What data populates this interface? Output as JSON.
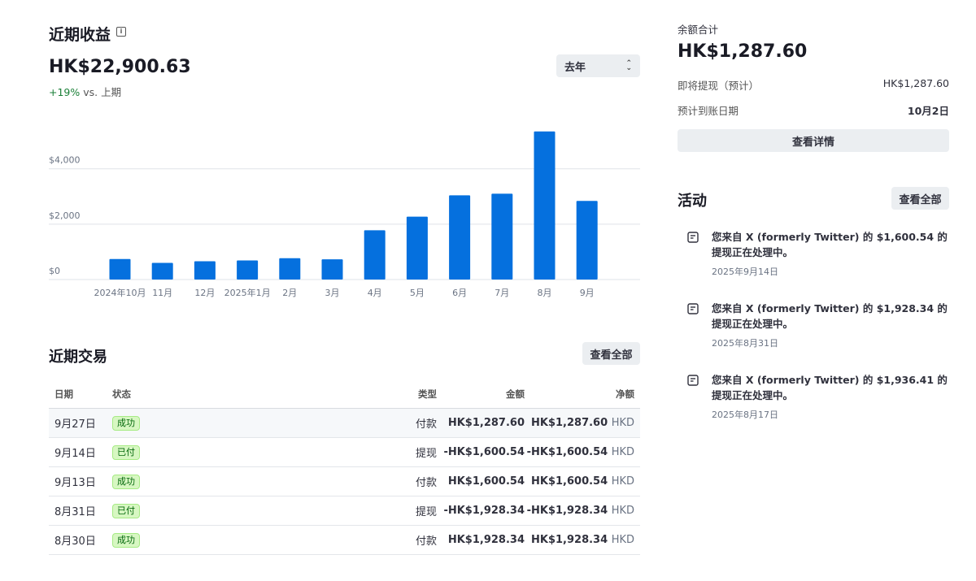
{
  "earnings": {
    "title": "近期收益",
    "total": "HK$22,900.63",
    "change_pct": "+19%",
    "change_suffix": " vs. 上期",
    "period_selected": "去年"
  },
  "chart_data": {
    "type": "bar",
    "categories": [
      "2024年10月",
      "11月",
      "12月",
      "2025年1月",
      "2月",
      "3月",
      "4月",
      "5月",
      "6月",
      "7月",
      "8月",
      "9月"
    ],
    "values": [
      740,
      600,
      660,
      690,
      770,
      730,
      1780,
      2270,
      3040,
      3100,
      5350,
      2840
    ],
    "ylim": [
      0,
      5400
    ],
    "yticks": [
      0,
      2000,
      4000
    ],
    "ytick_labels": [
      "$0",
      "$2,000",
      "$4,000"
    ],
    "grid": true,
    "bar_color": "#0570de"
  },
  "transactions": {
    "title": "近期交易",
    "view_all": "查看全部",
    "headers": {
      "date": "日期",
      "status": "状态",
      "type": "类型",
      "amount": "金额",
      "net": "净额"
    },
    "rows": [
      {
        "date": "9月27日",
        "status": "成功",
        "type": "付款",
        "amount": "HK$1,287.60",
        "net": "HK$1,287.60",
        "currency": "HKD"
      },
      {
        "date": "9月14日",
        "status": "已付",
        "type": "提现",
        "amount": "-HK$1,600.54",
        "net": "-HK$1,600.54",
        "currency": "HKD"
      },
      {
        "date": "9月13日",
        "status": "成功",
        "type": "付款",
        "amount": "HK$1,600.54",
        "net": "HK$1,600.54",
        "currency": "HKD"
      },
      {
        "date": "8月31日",
        "status": "已付",
        "type": "提现",
        "amount": "-HK$1,928.34",
        "net": "-HK$1,928.34",
        "currency": "HKD"
      },
      {
        "date": "8月30日",
        "status": "成功",
        "type": "付款",
        "amount": "HK$1,928.34",
        "net": "HK$1,928.34",
        "currency": "HKD"
      }
    ]
  },
  "balance": {
    "label": "余额合计",
    "amount": "HK$1,287.60",
    "upcoming_label": "即将提现（预计）",
    "upcoming_value": "HK$1,287.60",
    "arrival_label": "预计到账日期",
    "arrival_value": "10月2日",
    "details_button": "查看详情"
  },
  "activity": {
    "title": "活动",
    "view_all": "查看全部",
    "icon": "receipt-icon",
    "items": [
      {
        "text": "您来自 X (formerly Twitter) 的 $1,600.54 的提现正在处理中。",
        "date": "2025年9月14日"
      },
      {
        "text": "您来自 X (formerly Twitter) 的 $1,928.34 的提现正在处理中。",
        "date": "2025年8月31日"
      },
      {
        "text": "您来自 X (formerly Twitter) 的 $1,936.41 的提现正在处理中。",
        "date": "2025年8月17日"
      }
    ]
  }
}
